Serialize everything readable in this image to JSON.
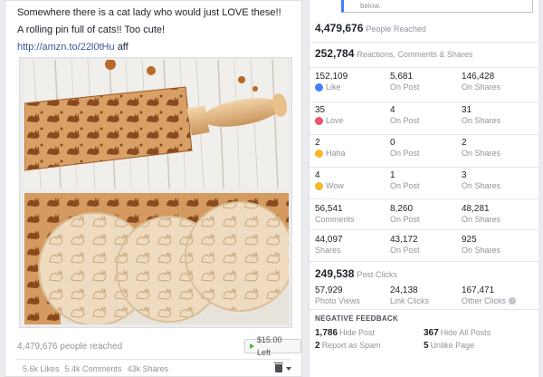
{
  "post": {
    "line1": "Somewhere there is a cat lady who would just LOVE these!!",
    "line2": "A rolling pin full of cats!! Too cute!",
    "link": "http://amzn.to/22l0tHu",
    "link_suffix": "aff",
    "people_reached": "4,479,676 people reached",
    "offer_button": "$15.00 Left",
    "likes": "5.6k Likes",
    "comments": "5.4k Comments",
    "shares": "43k Shares"
  },
  "insights": {
    "tooltip_text": "below.",
    "reach_value": "4,479,676",
    "reach_label": "People Reached",
    "engagement_value": "252,784",
    "engagement_label": "Reactions, Comments & Shares",
    "rows": [
      {
        "c1": {
          "num": "152,109",
          "label": "Like",
          "icon": "like-icon"
        },
        "c2": {
          "num": "5,681",
          "label": "On Post"
        },
        "c3": {
          "num": "146,428",
          "label": "On Shares"
        }
      },
      {
        "c1": {
          "num": "35",
          "label": "Love",
          "icon": "love-icon"
        },
        "c2": {
          "num": "4",
          "label": "On Post"
        },
        "c3": {
          "num": "31",
          "label": "On Shares"
        }
      },
      {
        "c1": {
          "num": "2",
          "label": "Haha",
          "icon": "haha-icon"
        },
        "c2": {
          "num": "0",
          "label": "On Post"
        },
        "c3": {
          "num": "2",
          "label": "On Shares"
        }
      },
      {
        "c1": {
          "num": "4",
          "label": "Wow",
          "icon": "wow-icon"
        },
        "c2": {
          "num": "1",
          "label": "On Post"
        },
        "c3": {
          "num": "3",
          "label": "On Shares"
        }
      },
      {
        "c1": {
          "num": "56,541",
          "label": "Comments"
        },
        "c2": {
          "num": "8,260",
          "label": "On Post"
        },
        "c3": {
          "num": "48,281",
          "label": "On Shares"
        }
      },
      {
        "c1": {
          "num": "44,097",
          "label": "Shares"
        },
        "c2": {
          "num": "43,172",
          "label": "On Post"
        },
        "c3": {
          "num": "925",
          "label": "On Shares"
        }
      }
    ],
    "clicks_value": "249,538",
    "clicks_label": "Post Clicks",
    "clicks": {
      "photo_num": "57,929",
      "photo_label": "Photo Views",
      "link_num": "24,138",
      "link_label": "Link Clicks",
      "other_num": "167,471",
      "other_label": "Other Clicks"
    },
    "negative_title": "NEGATIVE FEEDBACK",
    "negative": {
      "hide_post_num": "1,786",
      "hide_post_label": "Hide Post",
      "hide_all_num": "367",
      "hide_all_label": "Hide All Posts",
      "spam_num": "2",
      "spam_label": "Report as Spam",
      "unlike_num": "5",
      "unlike_label": "Unlike Page"
    }
  }
}
